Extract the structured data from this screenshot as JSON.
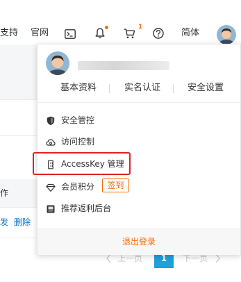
{
  "nav": {
    "support_label": "支持",
    "docs_label": "官网",
    "cart_count": "1",
    "language_label": "简体"
  },
  "background": {
    "action_header": "作",
    "link_resend": "发",
    "link_delete": "删除",
    "pager": {
      "prev_label": "上一页",
      "current_page": "1",
      "next_label": "下一页"
    }
  },
  "dropdown": {
    "account_links": [
      "基本资料",
      "实名认证",
      "安全设置"
    ],
    "menu": [
      {
        "label": "安全管控",
        "icon": "shield-icon"
      },
      {
        "label": "访问控制",
        "icon": "cloud-icon"
      },
      {
        "label": "AccessKey 管理",
        "icon": "key-icon"
      },
      {
        "label": "会员积分",
        "icon": "diamond-icon"
      },
      {
        "label": "推荐返利后台",
        "icon": "reward-icon"
      }
    ],
    "signin_label": "签到",
    "logout_label": "退出登录"
  },
  "colors": {
    "accent": "#ff6a00",
    "highlight": "#e22020",
    "link": "#0070cc",
    "page_active": "#1fa1da"
  }
}
